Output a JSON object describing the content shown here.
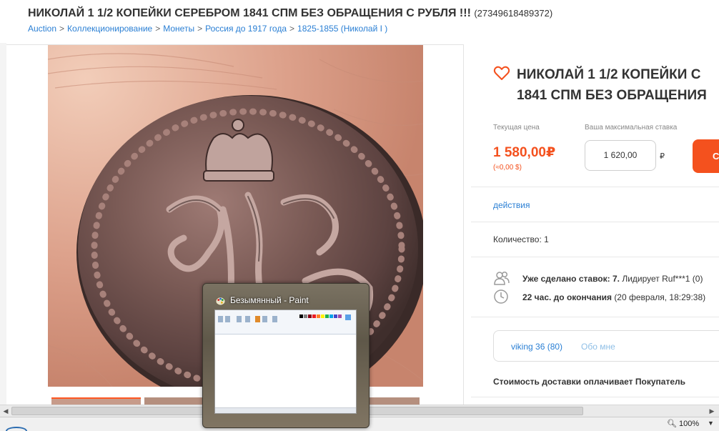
{
  "header": {
    "title": "НИКОЛАЙ 1 1/2 КОПЕЙКИ СЕРЕБРОМ 1841 СПМ БЕЗ ОБРАЩЕНИЯ С РУБЛЯ !!!",
    "lot_id": "(27349618489372)",
    "breadcrumb": [
      "Auction",
      "Коллекционирование",
      "Монеты",
      "Россия до 1917 года",
      "1825-1855 (Николай I )"
    ]
  },
  "lot": {
    "title_line1": "НИКОЛАЙ 1 1/2 КОПЕЙКИ С",
    "title_line2": "1841 СПМ БЕЗ ОБРАЩЕНИЯ",
    "current_price_label": "Текущая цена",
    "current_price": "1 580,00₽",
    "current_price_usd": "(≈0,00 $)",
    "max_bid_label": "Ваша максимальная ставка",
    "max_bid_value": "1 620,00",
    "currency_symbol": "₽",
    "bid_button_label": "С",
    "actions_label": "действия",
    "quantity": "Количество: 1",
    "bids_label": "Уже сделано ставок: 7.",
    "leader_text": "Лидирует Ruf***1 (0)",
    "time_left_label": "22 час. до окончания",
    "end_time": "(20 февраля, 18:29:38)",
    "seller_name": "viking 36 (80)",
    "seller_about": "Обо мне",
    "delivery": "Стоимость доставки оплачивает Покупатель"
  },
  "popup": {
    "window_title": "Безымянный - Paint"
  },
  "statusbar": {
    "zoom": "100%"
  },
  "colors": {
    "accent": "#f4511e",
    "link": "#2a7fd4"
  },
  "icons": [
    "heart-icon",
    "bidders-icon",
    "clock-icon",
    "paint-icon",
    "zoom-icon"
  ]
}
